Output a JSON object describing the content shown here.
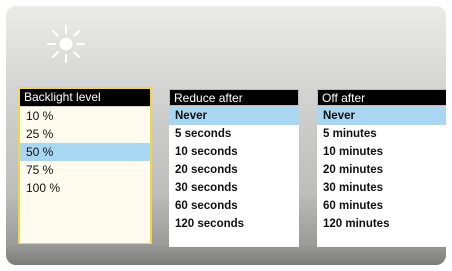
{
  "backlight": {
    "title": "Backlight level",
    "options": [
      "10 %",
      "25 %",
      "50 %",
      "75 %",
      "100 %"
    ],
    "selected": "50 %"
  },
  "reduce": {
    "title": "Reduce after",
    "options": [
      "Never",
      "5 seconds",
      "10 seconds",
      "20 seconds",
      "30 seconds",
      "60 seconds",
      "120 seconds"
    ],
    "selected": "Never"
  },
  "off": {
    "title": "Off after",
    "options": [
      "Never",
      "5 minutes",
      "10 minutes",
      "20 minutes",
      "30 minutes",
      "60 minutes",
      "120 minutes"
    ],
    "selected": "Never"
  },
  "icons": {
    "header": "brightness-icon"
  },
  "colors": {
    "selection": "#a9d7f2",
    "focus_border": "#f0d64a",
    "header_bg": "#000000"
  }
}
